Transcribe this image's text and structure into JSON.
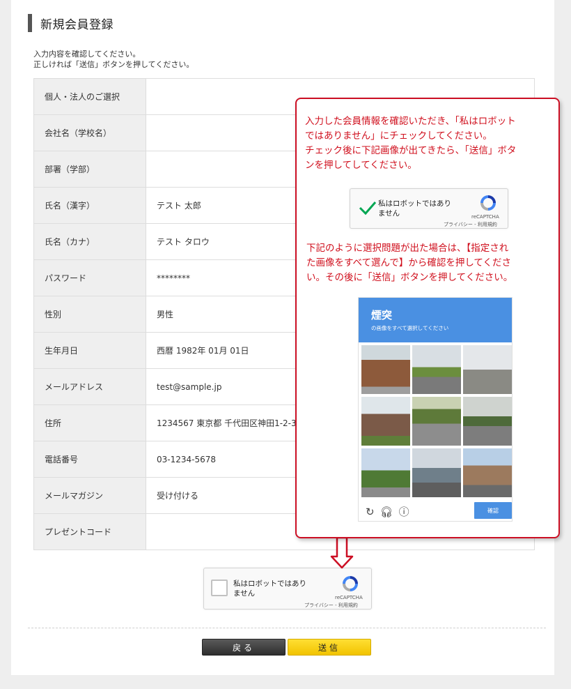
{
  "page": {
    "heading": "新規会員登録",
    "intro": [
      "入力内容を確認してください。",
      "正しければ「送信」ボタンを押してください。"
    ]
  },
  "form": {
    "rows": [
      {
        "label": "個人・法人のご選択",
        "value": ""
      },
      {
        "label": "会社名（学校名）",
        "value": ""
      },
      {
        "label": "部署（学部）",
        "value": ""
      },
      {
        "label": "氏名（漢字）",
        "value": "テスト 太郎"
      },
      {
        "label": "氏名（カナ）",
        "value": "テスト タロウ"
      },
      {
        "label": "パスワード",
        "value": "********"
      },
      {
        "label": "性別",
        "value": "男性"
      },
      {
        "label": "生年月日",
        "value": "西暦 1982年 01月 01日"
      },
      {
        "label": "メールアドレス",
        "value": "test@sample.jp"
      },
      {
        "label": "住所",
        "value": "1234567 東京都 千代田区神田1-2-3"
      },
      {
        "label": "電話番号",
        "value": "03-1234-5678"
      },
      {
        "label": "メールマガジン",
        "value": "受け付ける"
      },
      {
        "label": "プレゼントコード",
        "value": ""
      }
    ]
  },
  "recaptcha": {
    "label_line1": "私はロボットではあり",
    "label_line2": "ません",
    "brand": "reCAPTCHA",
    "links": "プライバシー - 利用規約"
  },
  "buttons": {
    "back": "戻る",
    "send": "送信"
  },
  "callout": {
    "text1": [
      "入力した会員情報を確認いただき、「私はロボット",
      "ではありません」にチェックしてください。",
      "チェック後に下記画像が出てきたら、「送信」ボタ",
      "ンを押してしてください。"
    ],
    "text2": [
      "下記のように選択問題が出た場合は、【指定され",
      "た画像をすべて選んで】から確認を押してくださ",
      "い。その後に「送信」ボタンを押してください。"
    ],
    "challenge": {
      "title": "煙突",
      "subtitle": "の画像をすべて選択してください",
      "verify_label": "確認",
      "icons": [
        "reload-icon",
        "headphones-icon",
        "info-icon"
      ]
    }
  },
  "colors": {
    "accent_red": "#cc0f24",
    "recaptcha_blue": "#4a90e2",
    "send_yellow": "#f5c900",
    "check_green": "#00a652"
  }
}
